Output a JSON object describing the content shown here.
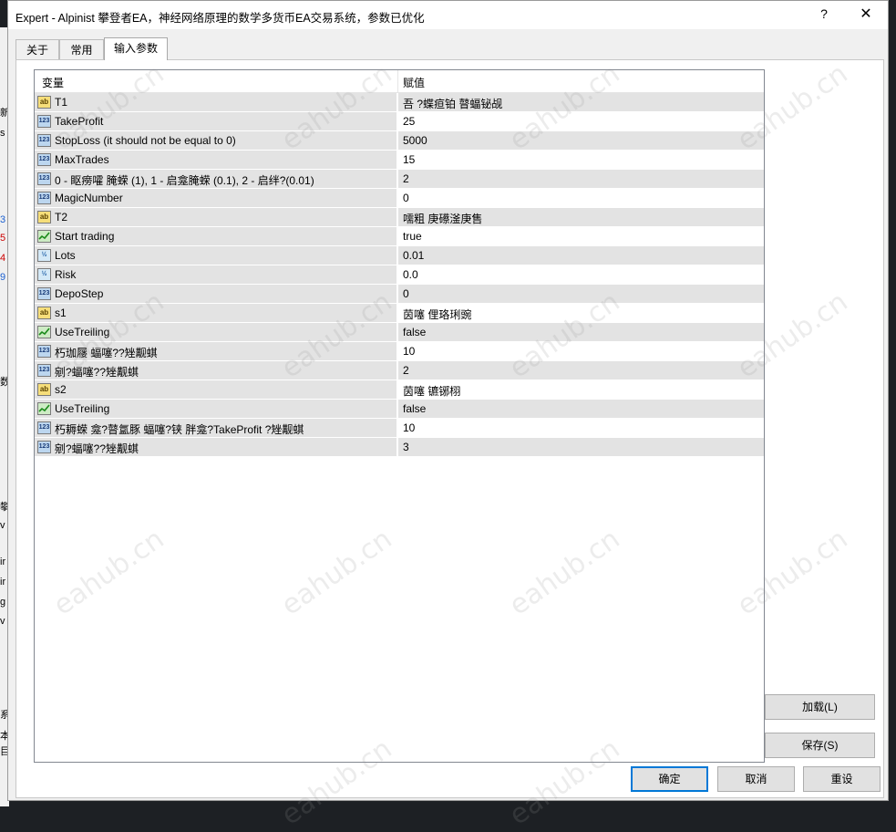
{
  "window": {
    "title": "Expert - Alpinist 攀登者EA，神经网络原理的数学多货币EA交易系统，参数已优化",
    "help_glyph": "?",
    "close_glyph": "✕"
  },
  "tabs": [
    {
      "label": "关于",
      "active": false
    },
    {
      "label": "常用",
      "active": false
    },
    {
      "label": "输入参数",
      "active": true
    }
  ],
  "table": {
    "col_variable": "变量",
    "col_value": "赋值",
    "rows": [
      {
        "type": "string",
        "icon": "ab",
        "name": "T1",
        "value": "吾   ?蝶疸铂     瞽蝠铋觇"
      },
      {
        "type": "int",
        "icon": "123",
        "name": "TakeProfit",
        "value": "25"
      },
      {
        "type": "int",
        "icon": "123",
        "name": "StopLoss (it should not be equal to 0)",
        "value": "5000"
      },
      {
        "type": "int",
        "icon": "123",
        "name": "MaxTrades",
        "value": "15"
      },
      {
        "type": "int",
        "icon": "123",
        "name": "0 - 眍痨嚯        腌蝾 (1), 1 - 启龛腌蝾 (0.1), 2 - 启绊?(0.01)",
        "value": "2"
      },
      {
        "type": "int",
        "icon": "123",
        "name": "MagicNumber",
        "value": "0"
      },
      {
        "type": "string",
        "icon": "ab",
        "name": "T2",
        "value": "嚅粗 庚礤滏庚售"
      },
      {
        "type": "bool",
        "icon": "bool",
        "name": "Start trading",
        "value": "true"
      },
      {
        "type": "double",
        "icon": "½",
        "name": "Lots",
        "value": "0.01"
      },
      {
        "type": "double",
        "icon": "½",
        "name": "Risk",
        "value": "0.0"
      },
      {
        "type": "int",
        "icon": "123",
        "name": "DepoStep",
        "value": "0"
      },
      {
        "type": "string",
        "icon": "ab",
        "name": "s1",
        "value": "茵噻 俚珞琍豌"
      },
      {
        "type": "bool",
        "icon": "bool",
        "name": "UseTreiling",
        "value": "false"
      },
      {
        "type": "int",
        "icon": "123",
        "name": "朽珈屦 蝠噻??矬觏蜞",
        "value": "10"
      },
      {
        "type": "int",
        "icon": "123",
        "name": "剜?蝠噻??矬觏蜞",
        "value": "2"
      },
      {
        "type": "string",
        "icon": "ab",
        "name": "s2",
        "value": "茵噻 镳铘栩"
      },
      {
        "type": "bool",
        "icon": "bool",
        "name": "UseTreiling",
        "value": "false"
      },
      {
        "type": "int",
        "icon": "123",
        "name": "朽耨蝾    龛?瞽氲豚 蝠噻?铗 胖龛?TakeProfit ?矬觏蜞",
        "value": "10"
      },
      {
        "type": "int",
        "icon": "123",
        "name": "剜?蝠噻??矬觏蜞",
        "value": "3"
      }
    ]
  },
  "buttons": {
    "load": "加载(L)",
    "save": "保存(S)",
    "ok": "确定",
    "cancel": "取消",
    "reset": "重设"
  },
  "watermark_text": "eahub.cn",
  "background_edge_glyphs": [
    "新",
    "s",
    "3",
    "5",
    "4",
    "9",
    "数",
    "攀",
    "v",
    "ir",
    "ir",
    "g",
    "v",
    "系",
    "本",
    "目"
  ]
}
